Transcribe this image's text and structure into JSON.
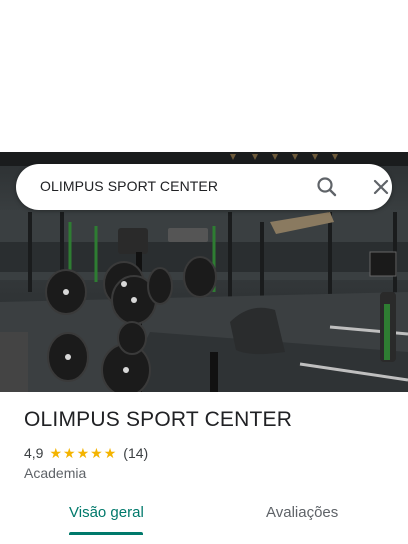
{
  "search": {
    "query": "OLIMPUS SPORT CENTER",
    "search_icon": "search-icon",
    "close_icon": "close-icon"
  },
  "place": {
    "name": "OLIMPUS SPORT CENTER",
    "rating": "4,9",
    "stars": 5,
    "review_count": "(14)",
    "category": "Academia",
    "photo": "gym-interior-photo"
  },
  "tabs": [
    {
      "label": "Visão geral",
      "selected": true
    },
    {
      "label": "Avaliações",
      "selected": false
    }
  ],
  "colors": {
    "accent": "#00796b",
    "star": "#f4b400",
    "text": "#202124",
    "secondary_text": "#5f6368"
  }
}
